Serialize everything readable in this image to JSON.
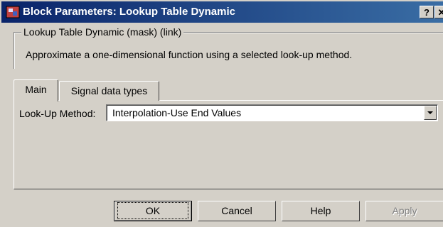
{
  "window": {
    "title": "Block Parameters: Lookup Table Dynamic",
    "help_button": "?",
    "close_button": "✕"
  },
  "group": {
    "legend": "Lookup Table Dynamic (mask) (link)",
    "description": "Approximate a one-dimensional function using a selected look-up method."
  },
  "tabs": [
    {
      "label": "Main",
      "selected": true
    },
    {
      "label": "Signal data types",
      "selected": false
    }
  ],
  "main": {
    "lookup_label": "Look-Up Method:",
    "lookup_value": "Interpolation-Use End Values"
  },
  "buttons": {
    "ok": "OK",
    "cancel": "Cancel",
    "help": "Help",
    "apply": "Apply"
  },
  "icons": {
    "app": "simulink-block-icon",
    "dropdown": "chevron-down-icon"
  },
  "colors": {
    "titlebar_start": "#0a246a",
    "titlebar_end": "#3a6ea5",
    "face": "#d4d0c8"
  }
}
